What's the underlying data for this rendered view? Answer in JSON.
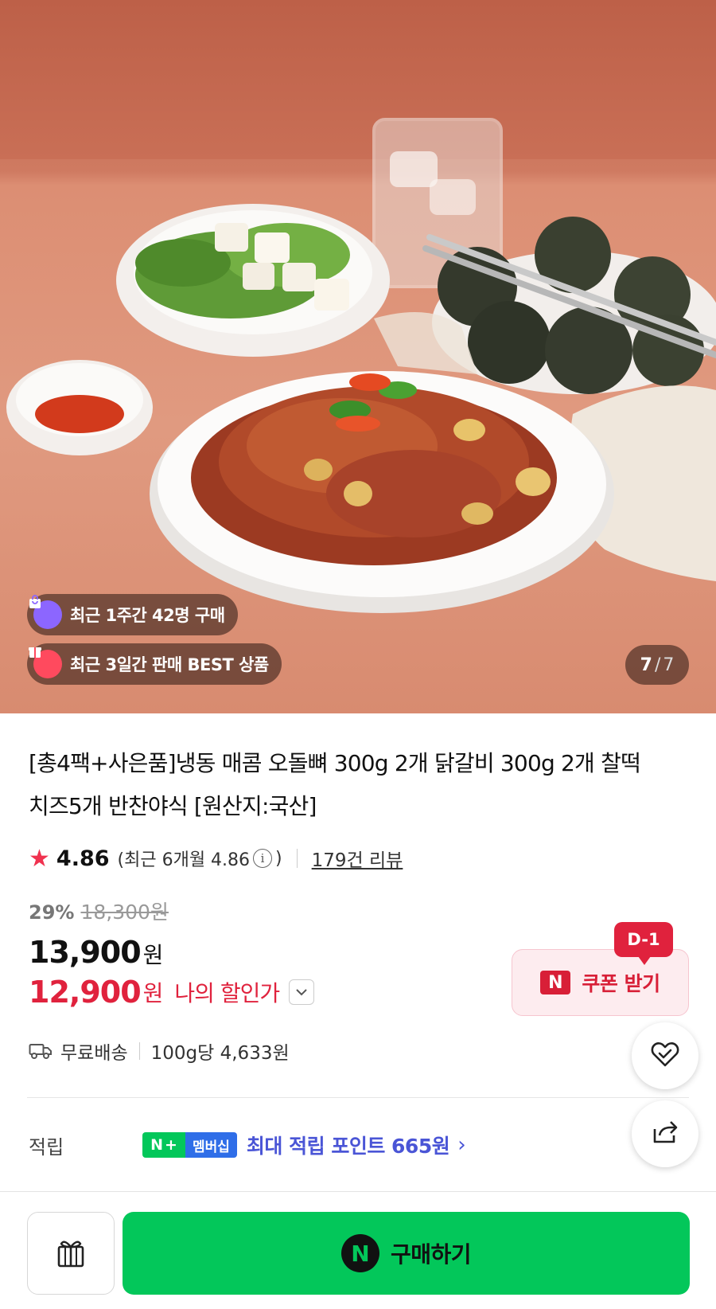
{
  "hero": {
    "badges": [
      {
        "icon": "shopping-bag-icon",
        "text": "최근 1주간 42명 구매",
        "color": "#8c66ff"
      },
      {
        "icon": "gift-box-icon",
        "text": "최근 3일간 판매 BEST 상품",
        "color": "#ff4a5e"
      }
    ],
    "counter": {
      "current": "7",
      "separator": "/",
      "total": "7"
    }
  },
  "product": {
    "title": "[총4팩+사은품]냉동 매콤 오돌뼈 300g 2개 닭갈비 300g 2개 찰떡치즈5개 반찬야식 [원산지:국산]"
  },
  "rating": {
    "score": "4.86",
    "recent_text": "(최근 6개월 4.86",
    "recent_close": ")",
    "reviews": "179건 리뷰"
  },
  "price": {
    "discount_rate": "29%",
    "original": "18,300원",
    "sale": "13,900",
    "sale_unit": "원",
    "my_price": "12,900",
    "my_unit": "원",
    "my_label": "나의 할인가"
  },
  "coupon": {
    "dday": "D-1",
    "label": "쿠폰 받기",
    "logo": "N"
  },
  "shipping": {
    "free": "무료배송",
    "unit_price": "100g당 4,633원"
  },
  "points": {
    "label": "적립",
    "badge_n": "N",
    "badge_plus": "+",
    "badge_membership": "멤버십",
    "text": "최대 적립 포인트 665원",
    "chevron": "›"
  },
  "actions": {
    "buy_label": "구매하기",
    "buy_logo": "N"
  },
  "colors": {
    "naver_green": "#03c75a",
    "sale_red": "#e0223d",
    "points_blue": "#4a55d6"
  }
}
